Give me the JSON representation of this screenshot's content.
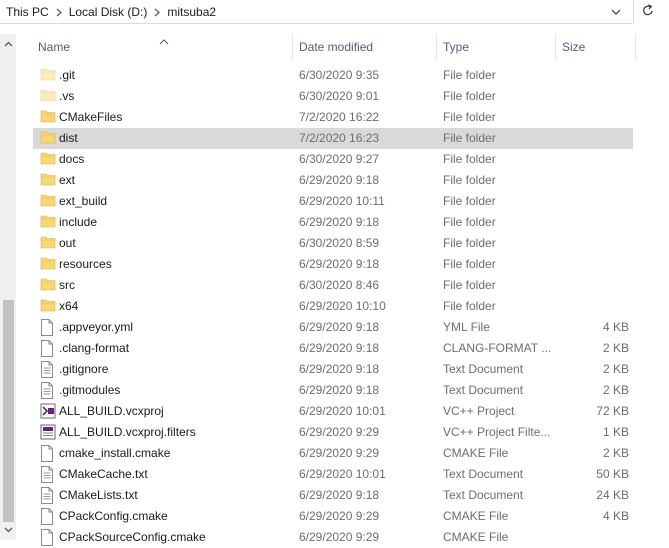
{
  "address_bar": {
    "crumbs": [
      "This PC",
      "Local Disk (D:)",
      "mitsuba2"
    ]
  },
  "columns": {
    "name": "Name",
    "date": "Date modified",
    "type": "Type",
    "size": "Size"
  },
  "files": [
    {
      "name": ".git",
      "date": "6/30/2020 9:35",
      "type": "File folder",
      "size": "",
      "icon": "folder-icon-hidden"
    },
    {
      "name": ".vs",
      "date": "6/30/2020 9:01",
      "type": "File folder",
      "size": "",
      "icon": "folder-icon-hidden"
    },
    {
      "name": "CMakeFiles",
      "date": "7/2/2020 16:22",
      "type": "File folder",
      "size": "",
      "icon": "folder-icon"
    },
    {
      "name": "dist",
      "date": "7/2/2020 16:23",
      "type": "File folder",
      "size": "",
      "icon": "folder-icon",
      "selected": true
    },
    {
      "name": "docs",
      "date": "6/30/2020 9:27",
      "type": "File folder",
      "size": "",
      "icon": "folder-icon"
    },
    {
      "name": "ext",
      "date": "6/29/2020 9:18",
      "type": "File folder",
      "size": "",
      "icon": "folder-icon"
    },
    {
      "name": "ext_build",
      "date": "6/29/2020 10:11",
      "type": "File folder",
      "size": "",
      "icon": "folder-icon"
    },
    {
      "name": "include",
      "date": "6/29/2020 9:18",
      "type": "File folder",
      "size": "",
      "icon": "folder-icon"
    },
    {
      "name": "out",
      "date": "6/30/2020 8:59",
      "type": "File folder",
      "size": "",
      "icon": "folder-icon"
    },
    {
      "name": "resources",
      "date": "6/29/2020 9:18",
      "type": "File folder",
      "size": "",
      "icon": "folder-icon"
    },
    {
      "name": "src",
      "date": "6/30/2020 8:46",
      "type": "File folder",
      "size": "",
      "icon": "folder-icon"
    },
    {
      "name": "x64",
      "date": "6/29/2020 10:10",
      "type": "File folder",
      "size": "",
      "icon": "folder-icon"
    },
    {
      "name": ".appveyor.yml",
      "date": "6/29/2020 9:18",
      "type": "YML File",
      "size": "4 KB",
      "icon": "file-icon"
    },
    {
      "name": ".clang-format",
      "date": "6/29/2020 9:18",
      "type": "CLANG-FORMAT ...",
      "size": "2 KB",
      "icon": "file-icon"
    },
    {
      "name": ".gitignore",
      "date": "6/29/2020 9:18",
      "type": "Text Document",
      "size": "2 KB",
      "icon": "text-file-icon"
    },
    {
      "name": ".gitmodules",
      "date": "6/29/2020 9:18",
      "type": "Text Document",
      "size": "2 KB",
      "icon": "text-file-icon"
    },
    {
      "name": "ALL_BUILD.vcxproj",
      "date": "6/29/2020 10:01",
      "type": "VC++ Project",
      "size": "72 KB",
      "icon": "vcxproj-icon"
    },
    {
      "name": "ALL_BUILD.vcxproj.filters",
      "date": "6/29/2020 9:29",
      "type": "VC++ Project Filte...",
      "size": "1 KB",
      "icon": "vcxproj-filters-icon"
    },
    {
      "name": "cmake_install.cmake",
      "date": "6/29/2020 9:29",
      "type": "CMAKE File",
      "size": "2 KB",
      "icon": "file-icon"
    },
    {
      "name": "CMakeCache.txt",
      "date": "6/29/2020 10:01",
      "type": "Text Document",
      "size": "50 KB",
      "icon": "text-file-icon"
    },
    {
      "name": "CMakeLists.txt",
      "date": "6/29/2020 9:18",
      "type": "Text Document",
      "size": "24 KB",
      "icon": "text-file-icon"
    },
    {
      "name": "CPackConfig.cmake",
      "date": "6/29/2020 9:29",
      "type": "CMAKE File",
      "size": "4 KB",
      "icon": "file-icon"
    },
    {
      "name": "CPackSourceConfig.cmake",
      "date": "6/29/2020 9:29",
      "type": "CMAKE File",
      "size": "",
      "icon": "file-icon"
    }
  ],
  "colors": {
    "folder": "#f8d775",
    "folder_hidden": "#fbecc0",
    "selected_row": "#d9d9d9",
    "header_text": "#4c607a"
  }
}
